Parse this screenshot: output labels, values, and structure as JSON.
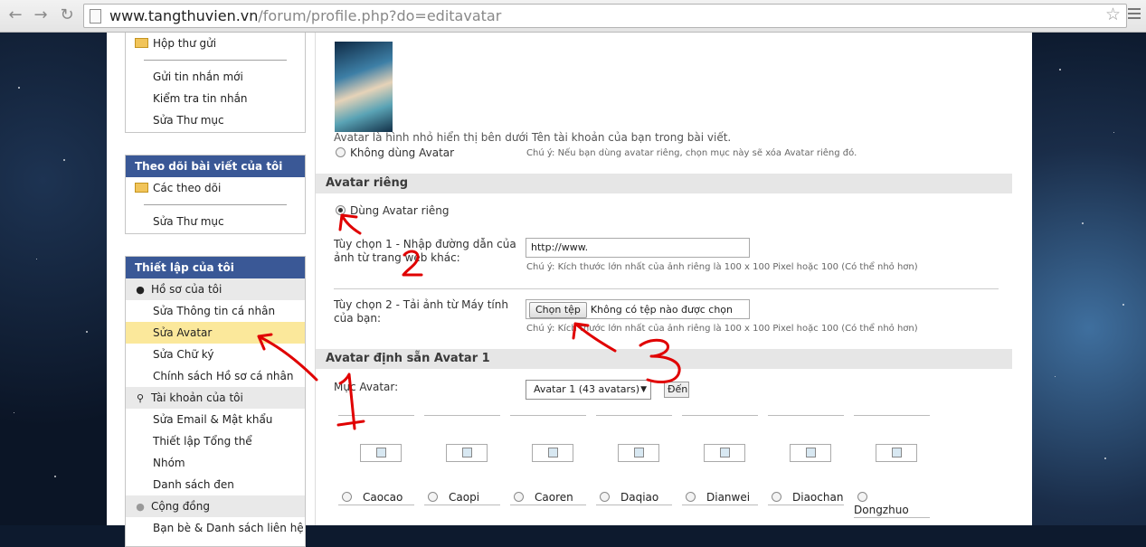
{
  "browser": {
    "url_host": "www.tangthuvien.vn",
    "url_path": "/forum/profile.php?do=editavatar"
  },
  "sidebar": {
    "inbox_box": {
      "folder_item": "Hộp thư gửi",
      "items": [
        "Gửi tin nhắn mới",
        "Kiểm tra tin nhắn",
        "Sửa Thư mục"
      ]
    },
    "subscriptions_box": {
      "title": "Theo dõi bài viết của tôi",
      "folder_item": "Các theo dõi",
      "items": [
        "Sửa Thư mục"
      ]
    },
    "settings_box": {
      "title": "Thiết lập của tôi",
      "profile_category": "Hồ sơ của tôi",
      "profile_items": [
        "Sửa Thông tin cá nhân",
        "Sửa Avatar",
        "Sửa Chữ ký",
        "Chính sách Hồ sơ cá nhân"
      ],
      "account_category": "Tài khoản của tôi",
      "account_items": [
        "Sửa Email & Mật khẩu",
        "Thiết lập Tổng thể",
        "Nhóm",
        "Danh sách đen"
      ],
      "community_category": "Cộng đồng",
      "community_items": [
        "Bạn bè & Danh sách liên hệ"
      ]
    }
  },
  "main": {
    "avatar_description": "Avatar là hình nhỏ hiển thị bên dưới Tên tài khoản của bạn trong bài viết.",
    "no_avatar_label": "Không dùng Avatar",
    "no_avatar_note": "Chú ý: Nếu bạn dùng avatar riêng, chọn mục này sẽ xóa Avatar riêng đó.",
    "custom_section": {
      "title": "Avatar riêng",
      "use_custom_label": "Dùng Avatar riêng",
      "option1_label_line1": "Tùy chọn 1 - Nhập đường dẫn của",
      "option1_label_line2": "ảnh từ trang web khác:",
      "url_value": "http://www.",
      "option1_note": "Chú ý: Kích thước lớn nhất của ảnh riêng là 100 x 100 Pixel hoặc 100 (Có thể nhỏ hơn)",
      "option2_label_line1": "Tùy chọn 2 - Tải ảnh từ Máy tính",
      "option2_label_line2": "của bạn:",
      "choose_file_label": "Chọn tệp",
      "no_file_text": "Không có tệp nào được chọn",
      "option2_note": "Chú ý: Kích thước lớn nhất của ảnh riêng là 100 x 100 Pixel hoặc 100 (Có thể nhỏ hơn)"
    },
    "preset_section": {
      "title": "Avatar định sẵn Avatar 1",
      "category_label": "Mục Avatar:",
      "category_selected": "Avatar 1 (43 avatars)",
      "go_label": "Đến",
      "avatars": [
        "Caocao",
        "Caopi",
        "Caoren",
        "Daqiao",
        "Dianwei",
        "Diaochan",
        "Dongzhuo"
      ]
    }
  },
  "icons": {
    "back": "back-arrow-icon",
    "forward": "forward-arrow-icon",
    "reload": "reload-icon",
    "bookmark": "star-icon",
    "menu": "hamburger-menu-icon"
  },
  "colors": {
    "box_header": "#3a5896",
    "highlight": "#fbe89b",
    "section_header": "#e6e6e6",
    "annotation": "#e00000"
  }
}
